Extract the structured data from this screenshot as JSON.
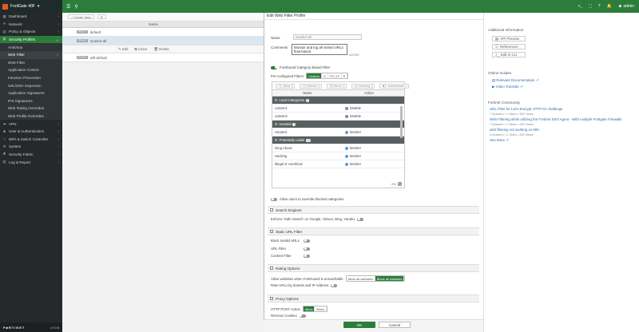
{
  "topbar": {
    "device": "FortiGate 40F",
    "user": "admin"
  },
  "sidebar": {
    "items": [
      {
        "label": "Dashboard",
        "icon": "dashboard-icon"
      },
      {
        "label": "Network",
        "icon": "network-icon"
      },
      {
        "label": "Policy & Objects",
        "icon": "policy-icon"
      },
      {
        "label": "Security Profiles",
        "icon": "shield-icon"
      },
      {
        "label": "AntiVirus"
      },
      {
        "label": "Web Filter"
      },
      {
        "label": "DNS Filter"
      },
      {
        "label": "Application Control"
      },
      {
        "label": "Intrusion Prevention"
      },
      {
        "label": "SSL/SSH Inspection"
      },
      {
        "label": "Application Signatures"
      },
      {
        "label": "IPS Signatures"
      },
      {
        "label": "Web Rating Overrides"
      },
      {
        "label": "Web Profile Overrides"
      },
      {
        "label": "VPN",
        "icon": "vpn-icon"
      },
      {
        "label": "User & Authentication",
        "icon": "user-icon"
      },
      {
        "label": "WiFi & Switch Controller",
        "icon": "wifi-icon"
      },
      {
        "label": "System",
        "icon": "gear-icon"
      },
      {
        "label": "Security Fabric",
        "icon": "fabric-icon"
      },
      {
        "label": "Log & Report",
        "icon": "log-icon"
      }
    ],
    "footer_brand": "F■RTINET",
    "version": "v7.0.5"
  },
  "list": {
    "create_label": "+ Create New",
    "edit_label": "Edit",
    "clone_label": "Clone",
    "delete_label": "Delete",
    "name_header": "Name",
    "rows": [
      {
        "tag": "PROF",
        "name": "default"
      },
      {
        "tag": "PROF",
        "name": "monitor-all"
      },
      {
        "tag": "PROF",
        "name": "wifi-default"
      }
    ]
  },
  "panel": {
    "title": "Edit Web Filter Profile",
    "name_label": "Name",
    "name_value": "monitor-all",
    "comments_label": "Comments",
    "comments_value": "Monitor and log all visited URLs flow-based",
    "comments_count": "45/255",
    "fortiguard_label": "FortiGuard Category Based Filter",
    "preconfigured_label": "Pre-configured Filters",
    "preconfigured_options": [
      "Custom",
      "G",
      "PG-13",
      "R"
    ],
    "cat_tools": [
      "Allow",
      "Monitor",
      "Block",
      "Warning",
      "Authenticate"
    ],
    "cat_headers": {
      "name": "Name",
      "action": "Action"
    },
    "categories": [
      {
        "type": "group",
        "name": "Local Categories",
        "count": "2"
      },
      {
        "type": "row",
        "name": "custom1",
        "action": "Disable",
        "color": "#888888"
      },
      {
        "type": "row",
        "name": "custom2",
        "action": "Disable",
        "color": "#888888"
      },
      {
        "type": "group",
        "name": "Unrated",
        "count": "1"
      },
      {
        "type": "row",
        "name": "Unrated",
        "action": "Monitor",
        "color": "#5b9bd5"
      },
      {
        "type": "group",
        "name": "Potentially Liable",
        "count": "12"
      },
      {
        "type": "row",
        "name": "Drug Abuse",
        "action": "Monitor",
        "color": "#5b9bd5"
      },
      {
        "type": "row",
        "name": "Hacking",
        "action": "Monitor",
        "color": "#5b9bd5"
      },
      {
        "type": "row",
        "name": "Illegal or Unethical",
        "action": "Monitor",
        "color": "#5b9bd5"
      }
    ],
    "progress": "0%",
    "override_label": "Allow users to override blocked categories",
    "search_section": "Search Engines",
    "safe_search_label": "Enforce 'Safe Search' on Google, Yahoo!, Bing, Yandex",
    "static_section": "Static URL Filter",
    "block_invalid_label": "Block invalid URLs",
    "url_filter_label": "URL Filter",
    "content_filter_label": "Content Filter",
    "rating_section": "Rating Options",
    "rating_behavior_label": "Allow websites when FortiGuard is unreachable",
    "rating_behavior_options": [
      "Allow all websites",
      "Block all websites"
    ],
    "rate_urls_label": "Rate URLs by domain and IP Address",
    "proxy_section": "Proxy Options",
    "http_post_label": "HTTP POST Action",
    "http_post_options": [
      "Allow",
      "Block"
    ],
    "remove_cookies_label": "Remove Cookies",
    "ok_label": "OK",
    "cancel_label": "Cancel"
  },
  "info": {
    "additional_title": "Additional Information",
    "api_preview": "API Preview",
    "references": "References",
    "edit_cli": "Edit in CLI",
    "online_guides": "Online Guides",
    "relevant_doc": "Relevant Documentation",
    "video_tutorials": "Video Tutorials",
    "community_title": "Fortinet Community",
    "posts": [
      {
        "title": "URL Filter for Let's Encrypt HTTP-01 challenge",
        "meta": "7 Answers  •  1 Video  •  399 Views"
      },
      {
        "title": "Web Filtering while utilizing the Fortinet SSO Agent - With multiple Fortigate Firewalls",
        "meta": "7 Answers  •  1 Video  •  199 Views"
      },
      {
        "title": "web filtering not working on 900",
        "meta": "4 Answers  •  1 Video  •  499 Views"
      }
    ],
    "see_more": "See More"
  }
}
